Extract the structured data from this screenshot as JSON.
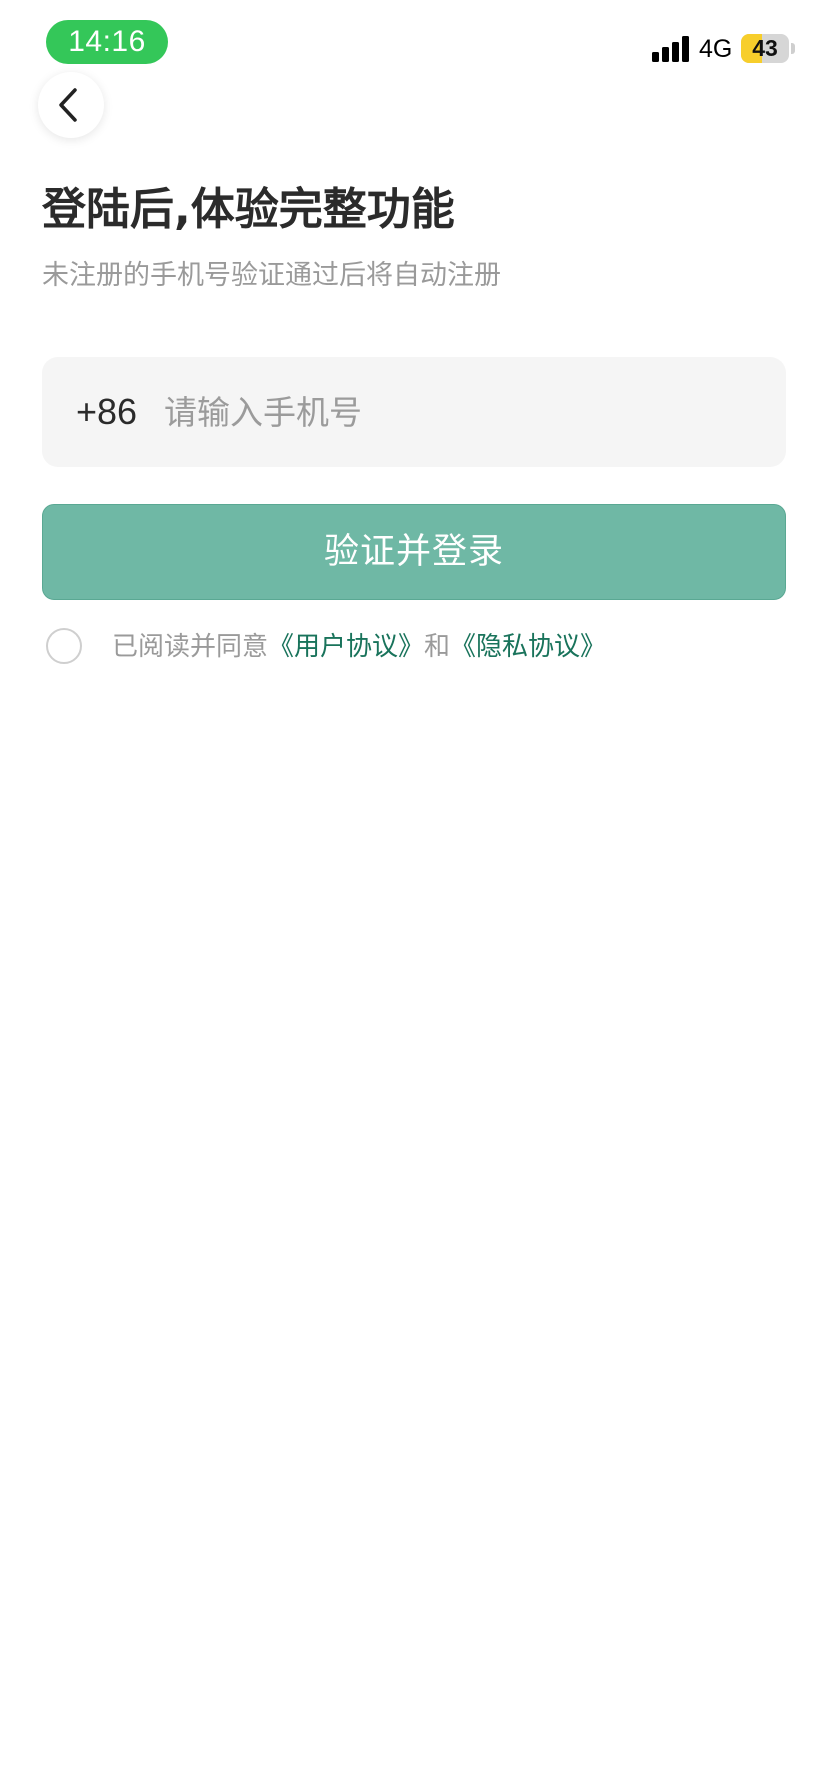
{
  "status_bar": {
    "time": "14:16",
    "network": "4G",
    "battery_level": "43",
    "battery_fraction": 0.43,
    "time_pill_color": "#34c759",
    "battery_color": "#f7ce2b"
  },
  "nav": {
    "back_icon": "chevron-left-icon"
  },
  "header": {
    "title": "登陆后,体验完整功能",
    "subtitle": "未注册的手机号验证通过后将自动注册"
  },
  "phone_field": {
    "country_code": "+86",
    "value": "",
    "placeholder": "请输入手机号"
  },
  "submit_button": {
    "label": "验证并登录",
    "color": "#6fb8a5"
  },
  "agreement": {
    "checked": false,
    "prefix": "已阅读并同意",
    "user_agreement": "《用户协议》",
    "conjunction": "和",
    "privacy_policy": "《隐私协议》",
    "link_color": "#19735b"
  }
}
